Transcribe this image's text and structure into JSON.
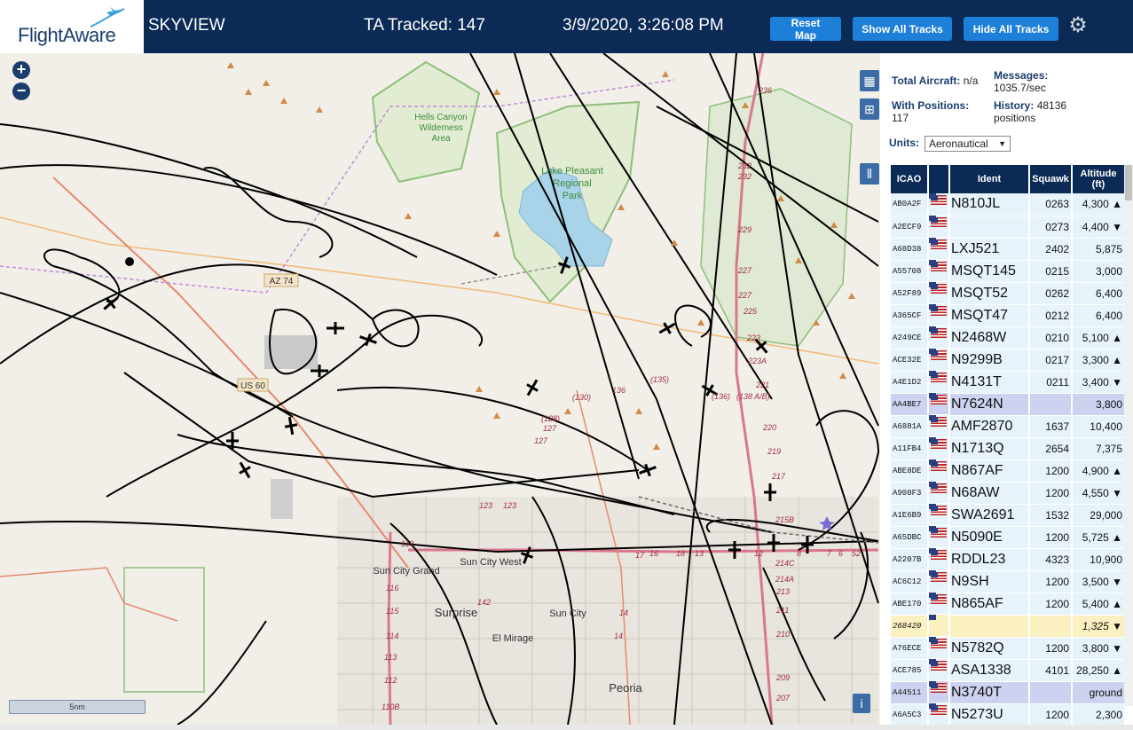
{
  "header": {
    "logo": "FlightAware",
    "title": "SKYVIEW",
    "tracked": "TA Tracked: 147",
    "datetime": "3/9/2020, 3:26:08 PM",
    "buttons": {
      "reset": "Reset Map",
      "show": "Show All Tracks",
      "hide": "Hide All Tracks"
    }
  },
  "map": {
    "labels": {
      "hells": "Hells Canyon",
      "wilderness": "Wilderness",
      "area": "Area",
      "lake1": "Lake Pleasant",
      "lake2": "Regional",
      "lake3": "Park",
      "az74": "AZ 74",
      "us60": "US 60",
      "sungrand": "Sun City Grand",
      "sunwest": "Sun City West",
      "surprise": "Surprise",
      "suncity": "Sun City",
      "elmirage": "El Mirage",
      "peoria": "Peoria",
      "r130": "(130)",
      "r135": "(135)",
      "r136": "(136)",
      "r138": "(138 A/B)",
      "r128": "(128)",
      "x127a": "127",
      "x127b": "127",
      "x123a": "123",
      "x123b": "123",
      "x236": "236",
      "x232a": "232",
      "x232b": "232",
      "x229": "229",
      "x227a": "227",
      "x227b": "227",
      "x225": "225",
      "x223": "223",
      "x223a": "223A",
      "x221": "221",
      "x220": "220",
      "x219": "219",
      "x217": "217",
      "x215b": "215B",
      "x214c": "214C",
      "x214a": "214A",
      "x213": "213",
      "x211": "211",
      "x210": "210",
      "x209": "209",
      "x207": "207",
      "x119": "119",
      "x116": "116",
      "x115": "115",
      "x114": "114",
      "x113": "113",
      "x112": "112",
      "x110b": "110B",
      "x142": "142",
      "x14a": "14",
      "x14b": "14",
      "x16": "16",
      "x17": "17",
      "x18": "18",
      "x13": "13",
      "x12": "12",
      "x8": "8",
      "x7": "7",
      "x6": "6",
      "x5": "5",
      "x2": "2",
      "x136b": "136"
    },
    "scale": "5nm",
    "zoom_in": "+",
    "zoom_out": "−"
  },
  "stats": {
    "total_label": "Total Aircraft:",
    "total_value": "n/a",
    "messages_label": "Messages:",
    "messages_value": "1035.7/sec",
    "withpos_label": "With Positions:",
    "withpos_value": "117",
    "history_label": "History:",
    "history_value": "48136",
    "history_unit": "positions",
    "units_label": "Units:",
    "units_value": "Aeronautical"
  },
  "table": {
    "headers": {
      "icao": "ICAO",
      "ident": "Ident",
      "squawk": "Squawk",
      "altitude": "Altitude (ft)"
    },
    "rows": [
      {
        "icao": "AB0A2F",
        "ident": "N810JL",
        "squawk": "0263",
        "alt": "4,300 ▲"
      },
      {
        "icao": "A2ECF9",
        "ident": "",
        "squawk": "0273",
        "alt": "4,400 ▼"
      },
      {
        "icao": "A68D38",
        "ident": "LXJ521",
        "squawk": "2402",
        "alt": "5,875"
      },
      {
        "icao": "A55708",
        "ident": "MSQT145",
        "squawk": "0215",
        "alt": "3,000"
      },
      {
        "icao": "A52F89",
        "ident": "MSQT52",
        "squawk": "0262",
        "alt": "6,400"
      },
      {
        "icao": "A365CF",
        "ident": "MSQT47",
        "squawk": "0212",
        "alt": "6,400"
      },
      {
        "icao": "A249CE",
        "ident": "N2468W",
        "squawk": "0210",
        "alt": "5,100 ▲"
      },
      {
        "icao": "ACE32E",
        "ident": "N9299B",
        "squawk": "0217",
        "alt": "3,300 ▲"
      },
      {
        "icao": "A4E1D2",
        "ident": "N4131T",
        "squawk": "0211",
        "alt": "3,400 ▼"
      },
      {
        "icao": "AA4BE7",
        "ident": "N7624N",
        "squawk": "",
        "alt": "3,800"
      },
      {
        "icao": "A6881A",
        "ident": "AMF2870",
        "squawk": "1637",
        "alt": "10,400"
      },
      {
        "icao": "A11FB4",
        "ident": "N1713Q",
        "squawk": "2654",
        "alt": "7,375"
      },
      {
        "icao": "ABE8DE",
        "ident": "N867AF",
        "squawk": "1200",
        "alt": "4,900 ▲"
      },
      {
        "icao": "A900F3",
        "ident": "N68AW",
        "squawk": "1200",
        "alt": "4,550 ▼"
      },
      {
        "icao": "A1E6B9",
        "ident": "SWA2691",
        "squawk": "1532",
        "alt": "29,000"
      },
      {
        "icao": "A65DBC",
        "ident": "N5090E",
        "squawk": "1200",
        "alt": "5,725 ▲"
      },
      {
        "icao": "A2207B",
        "ident": "RDDL23",
        "squawk": "4323",
        "alt": "10,900"
      },
      {
        "icao": "AC6C12",
        "ident": "N9SH",
        "squawk": "1200",
        "alt": "3,500 ▼"
      },
      {
        "icao": "ABE170",
        "ident": "N865AF",
        "squawk": "1200",
        "alt": "5,400 ▲"
      },
      {
        "icao": "268420",
        "ident": "",
        "squawk": "",
        "alt": "1,325 ▼"
      },
      {
        "icao": "A76ECE",
        "ident": "N5782Q",
        "squawk": "1200",
        "alt": "3,800 ▼"
      },
      {
        "icao": "ACE785",
        "ident": "ASA1338",
        "squawk": "4101",
        "alt": "28,250 ▲"
      },
      {
        "icao": "A44511",
        "ident": "N3740T",
        "squawk": "",
        "alt": "ground"
      },
      {
        "icao": "A6A5C3",
        "ident": "N5273U",
        "squawk": "1200",
        "alt": "2,300"
      }
    ]
  },
  "colors": {
    "header": "#0b2a55",
    "button": "#1e7fd8",
    "row": "#e6f3fb",
    "row_selected": "#ccd2ef",
    "row_highlight": "#fbf0c0",
    "track": "#000000",
    "highway": "#d9788d"
  }
}
